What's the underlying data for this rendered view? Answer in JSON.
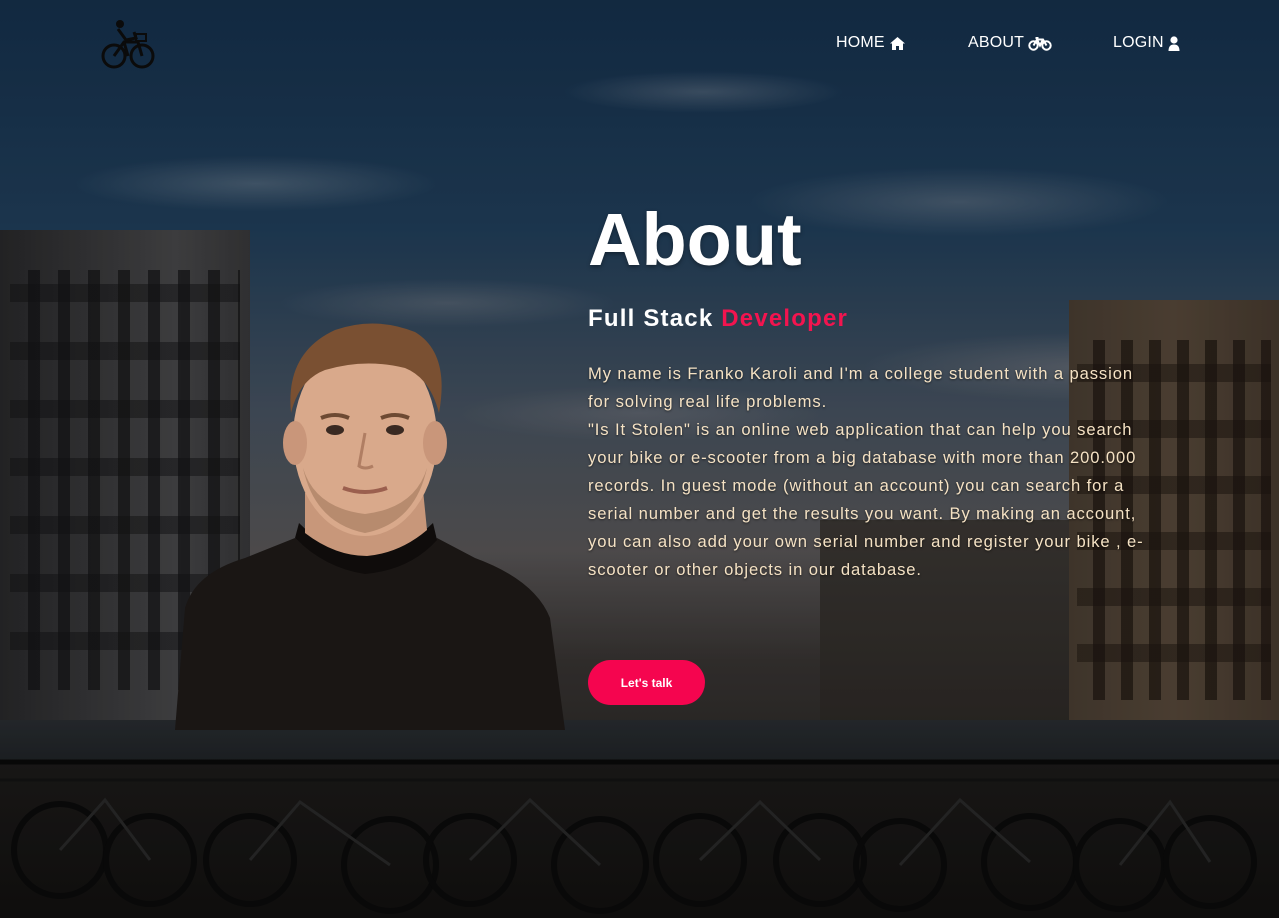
{
  "nav": {
    "items": [
      {
        "label": "HOME",
        "icon": "home-icon"
      },
      {
        "label": "ABOUT",
        "icon": "bicycle-icon"
      },
      {
        "label": "LOGIN",
        "icon": "user-icon"
      }
    ]
  },
  "hero": {
    "title": "About",
    "subtitle_main": "Full Stack",
    "subtitle_accent": "Developer",
    "paragraph_1": "My name is Franko Karoli and I'm a college student with a passion for solving real life problems.",
    "paragraph_2": "\"Is It Stolen\" is an online web application that can help you search your bike or e-scooter from a big database with more than 200.000 records. In guest mode (without an account) you can search for a serial number and get the results you want. By making an account, you can also add your own serial number and register your bike , e-scooter or other objects in our database.",
    "cta_label": "Let's talk"
  },
  "colors": {
    "accent": "#f3144f",
    "button": "#f5054f",
    "body_text": "#f5e2c4"
  }
}
